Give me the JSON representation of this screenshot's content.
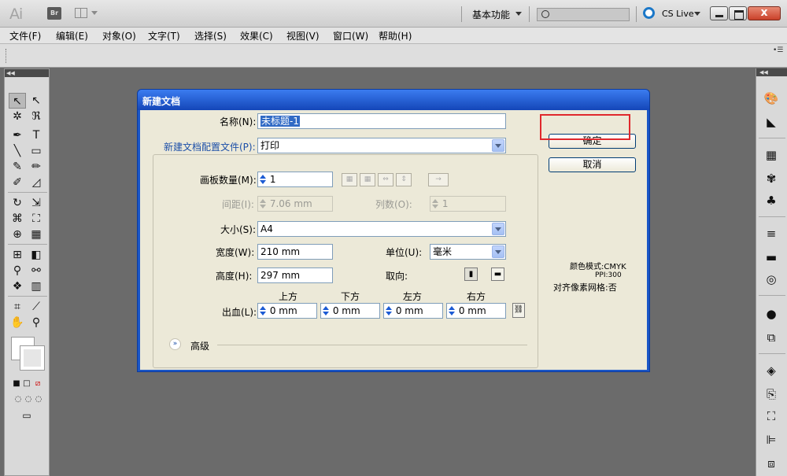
{
  "titlebar": {
    "app_logo": "Ai",
    "bridge_label": "Br",
    "workspace_label": "基本功能",
    "search_placeholder": "",
    "cslive_label": "CS Live",
    "close_glyph": "x"
  },
  "menu": [
    "文件(F)",
    "编辑(E)",
    "对象(O)",
    "文字(T)",
    "选择(S)",
    "效果(C)",
    "视图(V)",
    "窗口(W)",
    "帮助(H)"
  ],
  "dialog": {
    "title": "新建文档",
    "name_label": "名称(N):",
    "name_value": "未标题-1",
    "profile_label": "新建文档配置文件(P):",
    "profile_value": "打印",
    "artboards_label": "画板数量(M):",
    "artboards_value": "1",
    "spacing_label": "间距(I):",
    "spacing_value": "7.06 mm",
    "columns_label": "列数(O):",
    "columns_value": "1",
    "size_label": "大小(S):",
    "size_value": "A4",
    "width_label": "宽度(W):",
    "width_value": "210 mm",
    "units_label": "单位(U):",
    "units_value": "毫米",
    "height_label": "高度(H):",
    "height_value": "297 mm",
    "orientation_label": "取向:",
    "bleed_label": "出血(L):",
    "bleed_top_label": "上方",
    "bleed_bottom_label": "下方",
    "bleed_left_label": "左方",
    "bleed_right_label": "右方",
    "bleed_top": "0 mm",
    "bleed_bottom": "0 mm",
    "bleed_left": "0 mm",
    "bleed_right": "0 mm",
    "advanced_label": "高级",
    "ok_label": "确定",
    "cancel_label": "取消",
    "color_mode": "颜色模式:CMYK",
    "ppi": "PPI:300",
    "align_pixel": "对齐像素网格:否"
  },
  "colors": {
    "dialog_blue": "#1a56c7",
    "highlight_red": "#e0282d",
    "label_blue": "#1c4fa8"
  }
}
